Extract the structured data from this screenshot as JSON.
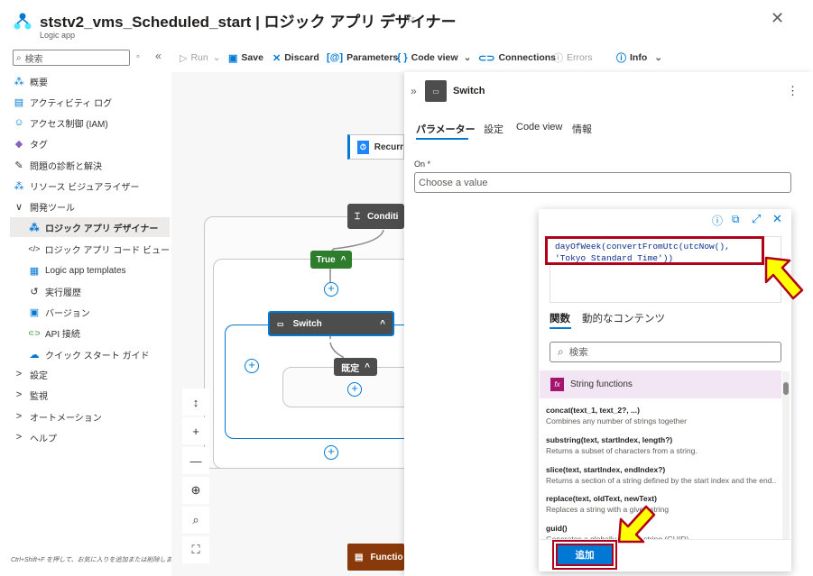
{
  "header": {
    "title": "ststv2_vms_Scheduled_start | ロジック アプリ デザイナー",
    "subtitle": "Logic app",
    "star_icon": "☆",
    "more_icon": "…",
    "close_icon": "✕"
  },
  "search": {
    "placeholder": "検索",
    "ctl_a": "◦",
    "ctl_b": "«"
  },
  "sidebar": {
    "items": [
      {
        "label": "概要",
        "icon": "⁂"
      },
      {
        "label": "アクティビティ ログ",
        "icon": "▤"
      },
      {
        "label": "アクセス制御 (IAM)",
        "icon": "☺"
      },
      {
        "label": "タグ",
        "icon": "◆"
      },
      {
        "label": "問題の診断と解決",
        "icon": "✎"
      },
      {
        "label": "リソース ビジュアライザー",
        "icon": "⁂"
      },
      {
        "label": "開発ツール",
        "icon": "∨"
      },
      {
        "label": "ロジック アプリ デザイナー",
        "icon": "⁂"
      },
      {
        "label": "ロジック アプリ コード ビュー",
        "icon": "</>"
      },
      {
        "label": "Logic app templates",
        "icon": "▦"
      },
      {
        "label": "実行履歴",
        "icon": "↺"
      },
      {
        "label": "バージョン",
        "icon": "▣"
      },
      {
        "label": "API 接続",
        "icon": "⊂⊃"
      },
      {
        "label": "クイック スタート ガイド",
        "icon": "☁"
      },
      {
        "label": "設定",
        "icon": ">"
      },
      {
        "label": "監視",
        "icon": ">"
      },
      {
        "label": "オートメーション",
        "icon": ">"
      },
      {
        "label": "ヘルプ",
        "icon": ">"
      }
    ],
    "hint": "Ctrl+Shift+F を押して、お気に入りを追加または削除します"
  },
  "toolbar": {
    "run": "Run",
    "save": "Save",
    "discard": "Discard",
    "parameters": "Parameters",
    "code_view": "Code view",
    "connections": "Connections",
    "errors": "Errors",
    "info": "Info"
  },
  "canvas": {
    "recurrence": "Recurr",
    "condition": "Conditi",
    "true_label": "True",
    "switch_label": "Switch",
    "default_label": "既定",
    "function_label": "Functio"
  },
  "panel": {
    "title": "Switch",
    "tabs": [
      "パラメーター",
      "設定",
      "Code view",
      "情報"
    ],
    "on_label": "On *",
    "on_placeholder": "Choose a value"
  },
  "expression": {
    "text": "dayOfWeek(convertFromUtc(utcNow(), 'Tokyo Standard Time'))",
    "tab_functions": "関数",
    "tab_dynamic": "動的なコンテンツ",
    "search_placeholder": "検索",
    "category": "String functions",
    "functions": [
      {
        "name": "concat(text_1, text_2?, ...)",
        "desc": "Combines any number of strings together"
      },
      {
        "name": "substring(text, startIndex, length?)",
        "desc": "Returns a subset of characters from a string."
      },
      {
        "name": "slice(text, startIndex, endIndex?)",
        "desc": "Returns a section of a string defined by the start index and the end..."
      },
      {
        "name": "replace(text, oldText, newText)",
        "desc": "Replaces a string with a given string"
      },
      {
        "name": "guid()",
        "desc": "Generates a globally unique string (GUID)"
      }
    ],
    "add_button": "追加"
  }
}
